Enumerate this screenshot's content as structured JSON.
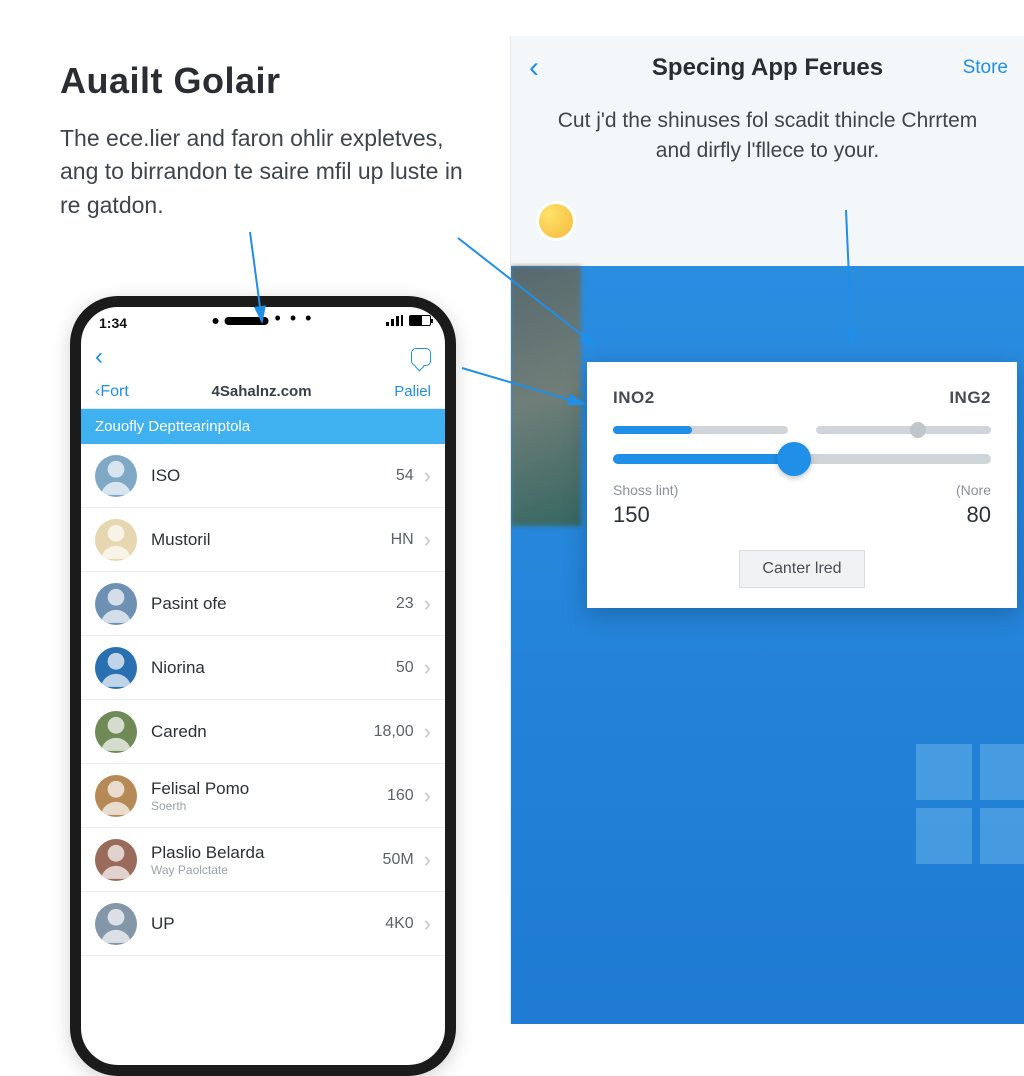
{
  "left": {
    "title": "Auailt Golair",
    "desc": "The ece.lier and faron ohlir expletves, ang to birrandon te saire mfil up luste in re gatdon."
  },
  "phone": {
    "time": "1:34",
    "nav1_chat_icon": "chat",
    "nav2": {
      "back": "‹Fort",
      "domain": "4Sahalnz.com",
      "action": "Paliel"
    },
    "section": "Zouofly Depttearinptola",
    "rows": [
      {
        "label": "ISO",
        "sub": "",
        "value": "54"
      },
      {
        "label": "Mustoril",
        "sub": "",
        "value": "HN"
      },
      {
        "label": "Pasint ofe",
        "sub": "",
        "value": "23"
      },
      {
        "label": "Niorina",
        "sub": "",
        "value": "50"
      },
      {
        "label": "Caredn",
        "sub": "",
        "value": "18,00"
      },
      {
        "label": "Felisal Pomo",
        "sub": "Soerth",
        "value": "160"
      },
      {
        "label": "Plaslio Belarda",
        "sub": "Way Paolctate",
        "value": "50M"
      },
      {
        "label": "UP",
        "sub": "",
        "value": "4K0"
      }
    ]
  },
  "right": {
    "title": "Specing App Ferues",
    "store": "Store",
    "desc": "Cut j'd the shinuses fol scadit thincle Chrrtem and dirfly l'fllece to your.",
    "card": {
      "label_left": "INO2",
      "label_right": "ING2",
      "scale_left": "Shoss lint)",
      "scale_right": "(Nore",
      "value_left": "150",
      "value_right": "80",
      "button": "Canter lred"
    }
  },
  "avatars": [
    "#7fa8c5",
    "#e6d7b0",
    "#6d90b3",
    "#2a6fb0",
    "#6f8a57",
    "#b68a57",
    "#9a6a5a",
    "#8397a8"
  ]
}
